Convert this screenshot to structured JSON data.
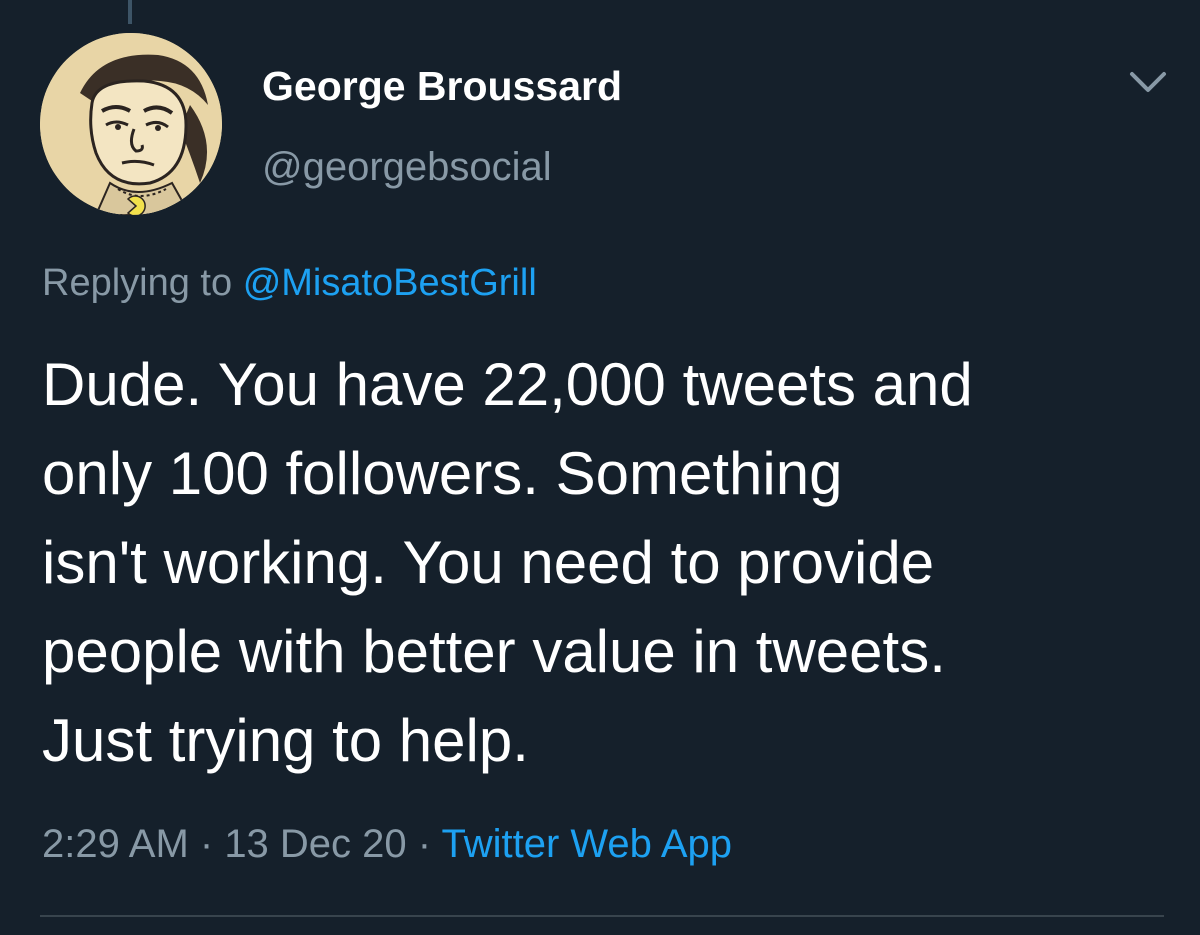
{
  "tweet": {
    "author": {
      "display_name": "George Broussard",
      "handle": "@georgebsocial",
      "avatar_icon": "cartoon-face-avatar"
    },
    "reply": {
      "prefix": "Replying to",
      "mention": "@MisatoBestGrill"
    },
    "lines": [
      "Dude. You have 22,000 tweets and",
      "only 100 followers. Something",
      "isn't working. You need to provide",
      "people with better value in tweets.",
      "Just trying to help."
    ],
    "meta": {
      "time": "2:29 AM",
      "separator": " · ",
      "date": "13 Dec 20",
      "source": "Twitter Web App"
    },
    "menu_icon": "chevron-down-icon"
  },
  "colors": {
    "background": "#15202b",
    "primary_text": "#ffffff",
    "secondary_text": "#8899a6",
    "accent": "#1da1f2",
    "divider": "#38444d"
  }
}
